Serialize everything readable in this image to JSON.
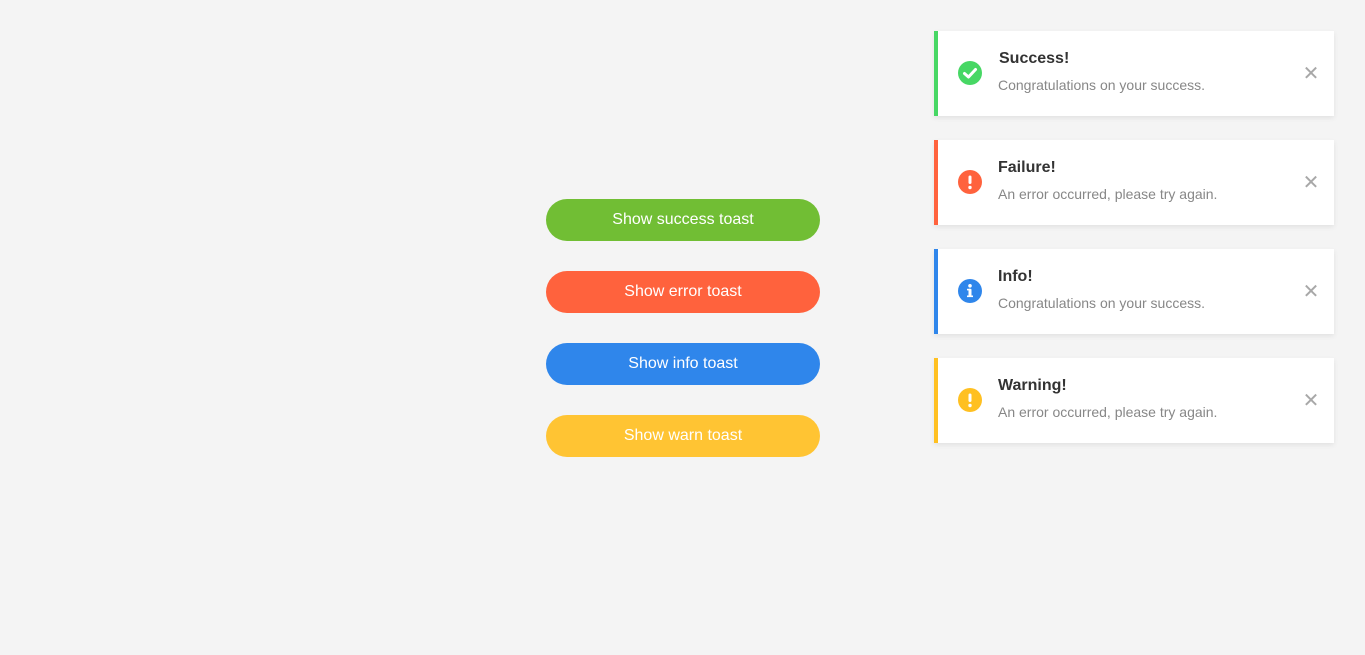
{
  "buttons": {
    "success_label": "Show success toast",
    "error_label": "Show error toast",
    "info_label": "Show info toast",
    "warn_label": "Show warn toast"
  },
  "toasts": [
    {
      "type": "success",
      "title": "Success!",
      "message": "Congratulations on your success.",
      "icon": "check-circle-icon",
      "close_glyph": "✕"
    },
    {
      "type": "error",
      "title": "Failure!",
      "message": "An error occurred, please try again.",
      "icon": "exclamation-circle-icon",
      "close_glyph": "✕"
    },
    {
      "type": "info",
      "title": "Info!",
      "message": "Congratulations on your success.",
      "icon": "info-circle-icon",
      "close_glyph": "✕"
    },
    {
      "type": "warn",
      "title": "Warning!",
      "message": "An error occurred, please try again.",
      "icon": "exclamation-circle-icon",
      "close_glyph": "✕"
    }
  ],
  "colors": {
    "background": "#f4f4f4",
    "success": "#47d764",
    "success_button": "#71be34",
    "error": "#ff623d",
    "info": "#2f86eb",
    "warn": "#ffc021",
    "warn_button": "#ffc433"
  }
}
